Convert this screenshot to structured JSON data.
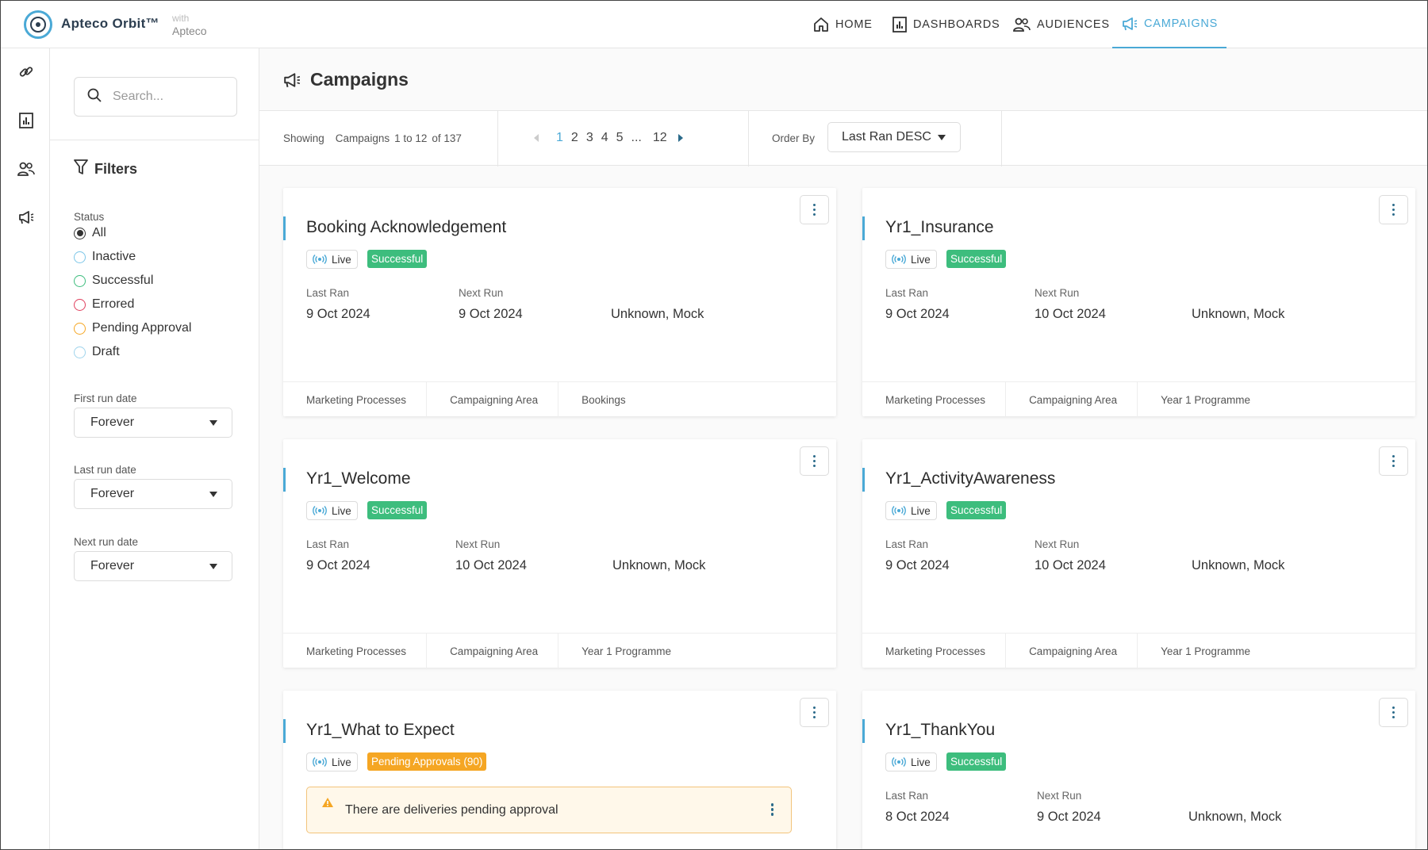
{
  "header": {
    "brand": "Apteco Orbit™",
    "with_label": "with",
    "with_name": "Apteco",
    "nav": [
      {
        "label": "HOME",
        "icon": "home-icon"
      },
      {
        "label": "DASHBOARDS",
        "icon": "dashboard-icon"
      },
      {
        "label": "AUDIENCES",
        "icon": "audiences-icon"
      },
      {
        "label": "CAMPAIGNS",
        "icon": "megaphone-icon",
        "active": true
      }
    ],
    "accent_color": "#4aa9d6"
  },
  "rail": [
    "link-icon",
    "dashboard-icon",
    "audiences-icon",
    "megaphone-icon"
  ],
  "filters": {
    "search_placeholder": "Search...",
    "title": "Filters",
    "status_label": "Status",
    "status_options": [
      {
        "label": "All",
        "selected": true,
        "color": "#333333"
      },
      {
        "label": "Inactive",
        "color": "#7cc6e8"
      },
      {
        "label": "Successful",
        "color": "#3dbd7d"
      },
      {
        "label": "Errored",
        "color": "#e0405e"
      },
      {
        "label": "Pending Approval",
        "color": "#f5a623"
      },
      {
        "label": "Draft",
        "color": "#9fd4ec"
      }
    ],
    "first_run_label": "First run date",
    "first_run_value": "Forever",
    "last_run_label": "Last run date",
    "last_run_value": "Forever",
    "next_run_label": "Next run date",
    "next_run_value": "Forever"
  },
  "main": {
    "title": "Campaigns",
    "showing_label": "Showing",
    "showing_entity": "Campaigns",
    "showing_range": "1 to 12",
    "showing_total": "of 137",
    "pages": [
      "1",
      "2",
      "3",
      "4",
      "5",
      "...",
      "12"
    ],
    "current_page": "1",
    "order_by_label": "Order By",
    "order_by_value": "Last Ran DESC"
  },
  "cards": [
    {
      "title": "Booking Acknowledgement",
      "live": "Live",
      "status": "Successful",
      "last_ran_label": "Last Ran",
      "last_ran": "9 Oct 2024",
      "next_run_label": "Next Run",
      "next_run": "9 Oct 2024",
      "owner": "Unknown, Mock",
      "tags": [
        "Marketing Processes",
        "Campaigning Area",
        "Bookings"
      ]
    },
    {
      "title": "Yr1_Insurance",
      "live": "Live",
      "status": "Successful",
      "last_ran_label": "Last Ran",
      "last_ran": "9 Oct 2024",
      "next_run_label": "Next Run",
      "next_run": "10 Oct 2024",
      "owner": "Unknown, Mock",
      "tags": [
        "Marketing Processes",
        "Campaigning Area",
        "Year 1 Programme"
      ]
    },
    {
      "title": "Yr1_Welcome",
      "live": "Live",
      "status": "Successful",
      "last_ran_label": "Last Ran",
      "last_ran": "9 Oct 2024",
      "next_run_label": "Next Run",
      "next_run": "10 Oct 2024",
      "owner": "Unknown, Mock",
      "tags": [
        "Marketing Processes",
        "Campaigning Area",
        "Year 1 Programme"
      ]
    },
    {
      "title": "Yr1_ActivityAwareness",
      "live": "Live",
      "status": "Successful",
      "last_ran_label": "Last Ran",
      "last_ran": "9 Oct 2024",
      "next_run_label": "Next Run",
      "next_run": "10 Oct 2024",
      "owner": "Unknown, Mock",
      "tags": [
        "Marketing Processes",
        "Campaigning Area",
        "Year 1 Programme"
      ]
    },
    {
      "title": "Yr1_What to Expect",
      "live": "Live",
      "status": "Pending Approvals (90)",
      "warning": "There are deliveries pending approval"
    },
    {
      "title": "Yr1_ThankYou",
      "live": "Live",
      "status": "Successful",
      "last_ran_label": "Last Ran",
      "last_ran": "8 Oct 2024",
      "next_run_label": "Next Run",
      "next_run": "9 Oct 2024",
      "owner": "Unknown, Mock"
    }
  ]
}
